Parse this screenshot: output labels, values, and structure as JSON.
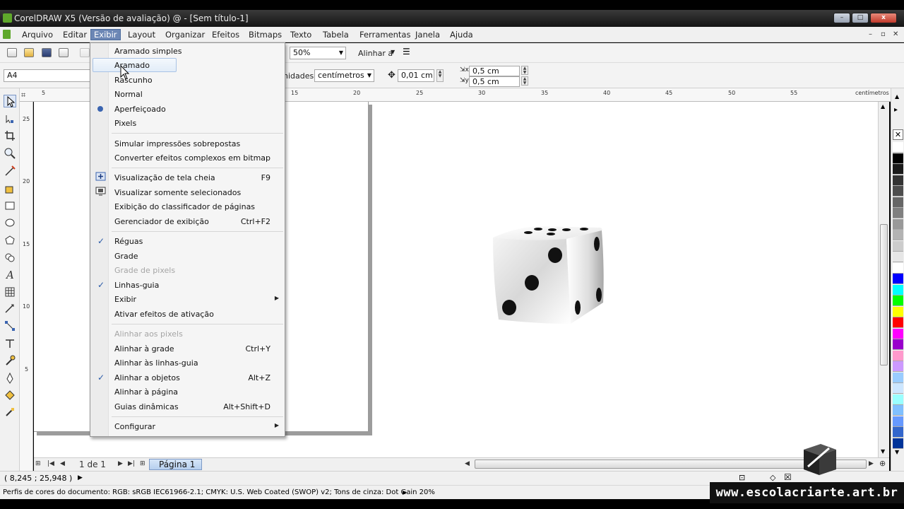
{
  "window": {
    "title": "CorelDRAW X5 (Versão de avaliação) @ - [Sem título-1]",
    "buttons": {
      "minimize": "–",
      "maximize": "□",
      "close": "x"
    }
  },
  "menubar": {
    "items": [
      "Arquivo",
      "Editar",
      "Exibir",
      "Layout",
      "Organizar",
      "Efeitos",
      "Bitmaps",
      "Texto",
      "Tabela",
      "Ferramentas",
      "Janela",
      "Ajuda"
    ],
    "active": "Exibir"
  },
  "toolbar": {
    "zoom": "50%",
    "snap_label": "Alinhar a",
    "page_size": "A4",
    "units_label": "nidades:",
    "units_value": "centímetros",
    "nudge": "0,01 cm",
    "dup_x": "0,5 cm",
    "dup_y": "0,5 cm"
  },
  "rulers": {
    "horizontal_ticks": [
      "5",
      "15",
      "20",
      "25",
      "30",
      "35",
      "40",
      "45",
      "50",
      "55"
    ],
    "vertical_ticks": [
      "25",
      "20",
      "15",
      "10",
      "5"
    ],
    "unit_label": "centímetros"
  },
  "menu": {
    "items": [
      {
        "label": "Aramado simples",
        "state": "normal"
      },
      {
        "label": "Aramado",
        "state": "highlighted"
      },
      {
        "label": "Rascunho",
        "state": "normal"
      },
      {
        "label": "Normal",
        "state": "normal"
      },
      {
        "label": "Aperfeiçoado",
        "state": "radio"
      },
      {
        "label": "Pixels",
        "state": "normal"
      },
      {
        "label": "Simular impressões sobrepostas",
        "state": "normal"
      },
      {
        "label": "Converter efeitos complexos em bitmap",
        "state": "normal"
      },
      {
        "label": "Visualização de tela cheia",
        "shortcut": "F9",
        "icon": "fullscreen-icon"
      },
      {
        "label": "Visualizar somente selecionados",
        "icon": "view-selected-icon"
      },
      {
        "label": "Exibição do classificador de páginas"
      },
      {
        "label": "Gerenciador de exibição",
        "shortcut": "Ctrl+F2"
      },
      {
        "label": "Réguas",
        "state": "checked"
      },
      {
        "label": "Grade"
      },
      {
        "label": "Grade de pixels",
        "state": "disabled"
      },
      {
        "label": "Linhas-guia",
        "state": "checked"
      },
      {
        "label": "Exibir",
        "submenu": true
      },
      {
        "label": "Ativar efeitos de ativação"
      },
      {
        "label": "Alinhar aos pixels",
        "state": "disabled"
      },
      {
        "label": "Alinhar à grade",
        "shortcut": "Ctrl+Y"
      },
      {
        "label": "Alinhar às linhas-guia"
      },
      {
        "label": "Alinhar a objetos",
        "shortcut": "Alt+Z",
        "state": "checked"
      },
      {
        "label": "Alinhar à página"
      },
      {
        "label": "Guias dinâmicas",
        "shortcut": "Alt+Shift+D"
      },
      {
        "label": "Configurar",
        "submenu": true
      }
    ]
  },
  "pagenav": {
    "counter": "1 de 1",
    "tab": "Página 1"
  },
  "status": {
    "coords": "( 8,245 ; 25,948 )",
    "profile": "Perfis de cores do documento: RGB: sRGB IEC61966-2.1; CMYK: U.S. Web Coated (SWOP) v2; Tons de cinza: Dot Gain 20%"
  },
  "watermark": "www.escolacriarte.art.br",
  "palette": [
    "#ffffff",
    "#000000",
    "#1a1a1a",
    "#333333",
    "#4d4d4d",
    "#666666",
    "#808080",
    "#999999",
    "#b3b3b3",
    "#cccccc",
    "#e6e6e6",
    "#ffffff",
    "#0000ff",
    "#00ffff",
    "#00ff00",
    "#ffff00",
    "#ff0000",
    "#ff00ff",
    "#9900cc",
    "#ff99cc",
    "#cc99ff",
    "#99ccff",
    "#cce6ff",
    "#99ffff",
    "#80c0ff",
    "#6699ff",
    "#3366cc",
    "#003399"
  ]
}
